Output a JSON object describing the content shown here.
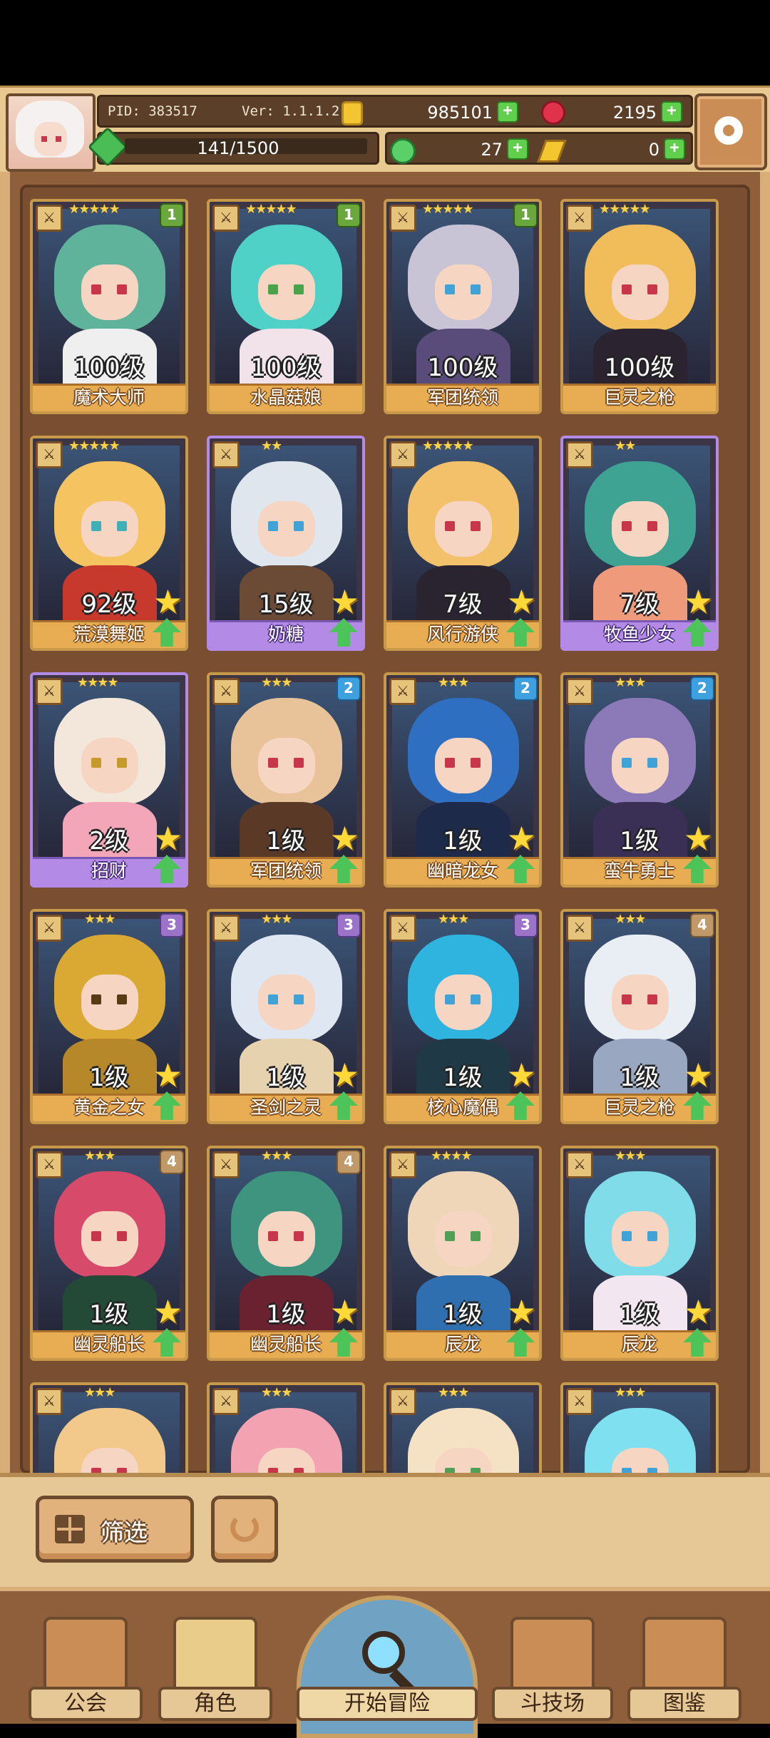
{
  "header": {
    "pid": "PID: 383517",
    "version": "Ver: 1.1.1.2",
    "gold": "985101",
    "gems": "2195",
    "energy": "141/1500",
    "clover": "27",
    "keys": "0"
  },
  "roster": [
    {
      "name": "魔术大师",
      "level": "100级",
      "stars": "★★★★★",
      "badge": "1",
      "frame": "gold",
      "hair": "#5fb39a",
      "body": "#efefef",
      "eye": "#c8364c"
    },
    {
      "name": "水晶菇娘",
      "level": "100级",
      "stars": "★★★★★",
      "badge": "1",
      "frame": "gold",
      "hair": "#4fd1c7",
      "body": "#f2e2ea",
      "eye": "#49a34b"
    },
    {
      "name": "军团统领",
      "level": "100级",
      "stars": "★★★★★",
      "badge": "1",
      "frame": "gold",
      "hair": "#c9c3d6",
      "body": "#5a4c7a",
      "eye": "#3fa3d8"
    },
    {
      "name": "巨灵之枪",
      "level": "100级",
      "stars": "★★★★★",
      "badge": "",
      "frame": "gold",
      "hair": "#f0bd5a",
      "body": "#2b2330",
      "eye": "#c8364c"
    },
    {
      "name": "荒漠舞姬",
      "level": "92级",
      "stars": "★★★★★",
      "badge": "",
      "frame": "gold",
      "hair": "#f5c460",
      "body": "#c7392d",
      "eye": "#3fb0b6"
    },
    {
      "name": "奶糖",
      "level": "15级",
      "stars": "★★",
      "badge": "",
      "frame": "purple",
      "hair": "#dfe6ee",
      "body": "#6b4a36",
      "eye": "#3fa3d8"
    },
    {
      "name": "风行游侠",
      "level": "7级",
      "stars": "★★★★★",
      "badge": "",
      "frame": "gold",
      "hair": "#f2c16a",
      "body": "#2a2430",
      "eye": "#c8364c"
    },
    {
      "name": "牧鱼少女",
      "level": "7级",
      "stars": "★★",
      "badge": "",
      "frame": "purple",
      "hair": "#3fa394",
      "body": "#f09a7c",
      "eye": "#c8364c"
    },
    {
      "name": "招财",
      "level": "2级",
      "stars": "★★★★",
      "badge": "",
      "frame": "purple",
      "hair": "#f3e6da",
      "body": "#f2a6b8",
      "eye": "#c49a2d"
    },
    {
      "name": "军团统领",
      "level": "1级",
      "stars": "★★★",
      "badge": "2",
      "frame": "gold",
      "hair": "#e8c39a",
      "body": "#5a3a26",
      "eye": "#c8364c"
    },
    {
      "name": "幽暗龙女",
      "level": "1级",
      "stars": "★★★",
      "badge": "2",
      "frame": "gold",
      "hair": "#2f6fc1",
      "body": "#1e2a4a",
      "eye": "#c8364c"
    },
    {
      "name": "蛮牛勇士",
      "level": "1级",
      "stars": "★★★",
      "badge": "2",
      "frame": "gold",
      "hair": "#8c79b8",
      "body": "#3a2f55",
      "eye": "#3fa3d8"
    },
    {
      "name": "黄金之女",
      "level": "1级",
      "stars": "★★★",
      "badge": "3",
      "frame": "gold",
      "hair": "#d9a933",
      "body": "#b7882a",
      "eye": "#5a3a14"
    },
    {
      "name": "圣剑之灵",
      "level": "1级",
      "stars": "★★★",
      "badge": "3",
      "frame": "gold",
      "hair": "#dfe7f2",
      "body": "#e7d2b0",
      "eye": "#3fa3d8"
    },
    {
      "name": "核心魔偶",
      "level": "1级",
      "stars": "★★★",
      "badge": "3",
      "frame": "gold",
      "hair": "#2fb4e0",
      "body": "#1f3a46",
      "eye": "#3fa3d8"
    },
    {
      "name": "巨灵之枪",
      "level": "1级",
      "stars": "★★★",
      "badge": "4",
      "frame": "gold",
      "hair": "#e9edf4",
      "body": "#9aa7c0",
      "eye": "#c8364c"
    },
    {
      "name": "幽灵船长",
      "level": "1级",
      "stars": "★★★",
      "badge": "4",
      "frame": "gold",
      "hair": "#d84a6a",
      "body": "#234a36",
      "eye": "#c8364c"
    },
    {
      "name": "幽灵船长",
      "level": "1级",
      "stars": "★★★",
      "badge": "4",
      "frame": "gold",
      "hair": "#3f9480",
      "body": "#6b2230",
      "eye": "#c8364c"
    },
    {
      "name": "辰龙",
      "level": "1级",
      "stars": "★★★★",
      "badge": "",
      "frame": "gold",
      "hair": "#efd6b8",
      "body": "#2f6fb0",
      "eye": "#4f9f55"
    },
    {
      "name": "辰龙",
      "level": "1级",
      "stars": "★★★",
      "badge": "",
      "frame": "gold",
      "hair": "#7fdce8",
      "body": "#f2e6f0",
      "eye": "#3fa3d8"
    },
    {
      "name": "",
      "level": "",
      "stars": "★★★",
      "badge": "",
      "frame": "gold",
      "hair": "#f2c98a",
      "body": "#c8364c",
      "eye": "#c8364c"
    },
    {
      "name": "",
      "level": "",
      "stars": "★★★",
      "badge": "",
      "frame": "gold",
      "hair": "#f3a2b2",
      "body": "#e9d2a6",
      "eye": "#c8364c"
    },
    {
      "name": "",
      "level": "",
      "stars": "★★★",
      "badge": "",
      "frame": "gold",
      "hair": "#f5e2c4",
      "body": "#c4d6e6",
      "eye": "#4f9f55"
    },
    {
      "name": "",
      "level": "",
      "stars": "★★★",
      "badge": "",
      "frame": "gold",
      "hair": "#7fe0f0",
      "body": "#d6f4f8",
      "eye": "#3fa3d8"
    }
  ],
  "filter": {
    "label": "筛选"
  },
  "nav": {
    "guild": "公会",
    "character": "角色",
    "adventure": "开始冒险",
    "arena": "斗技场",
    "codex": "图鉴"
  }
}
